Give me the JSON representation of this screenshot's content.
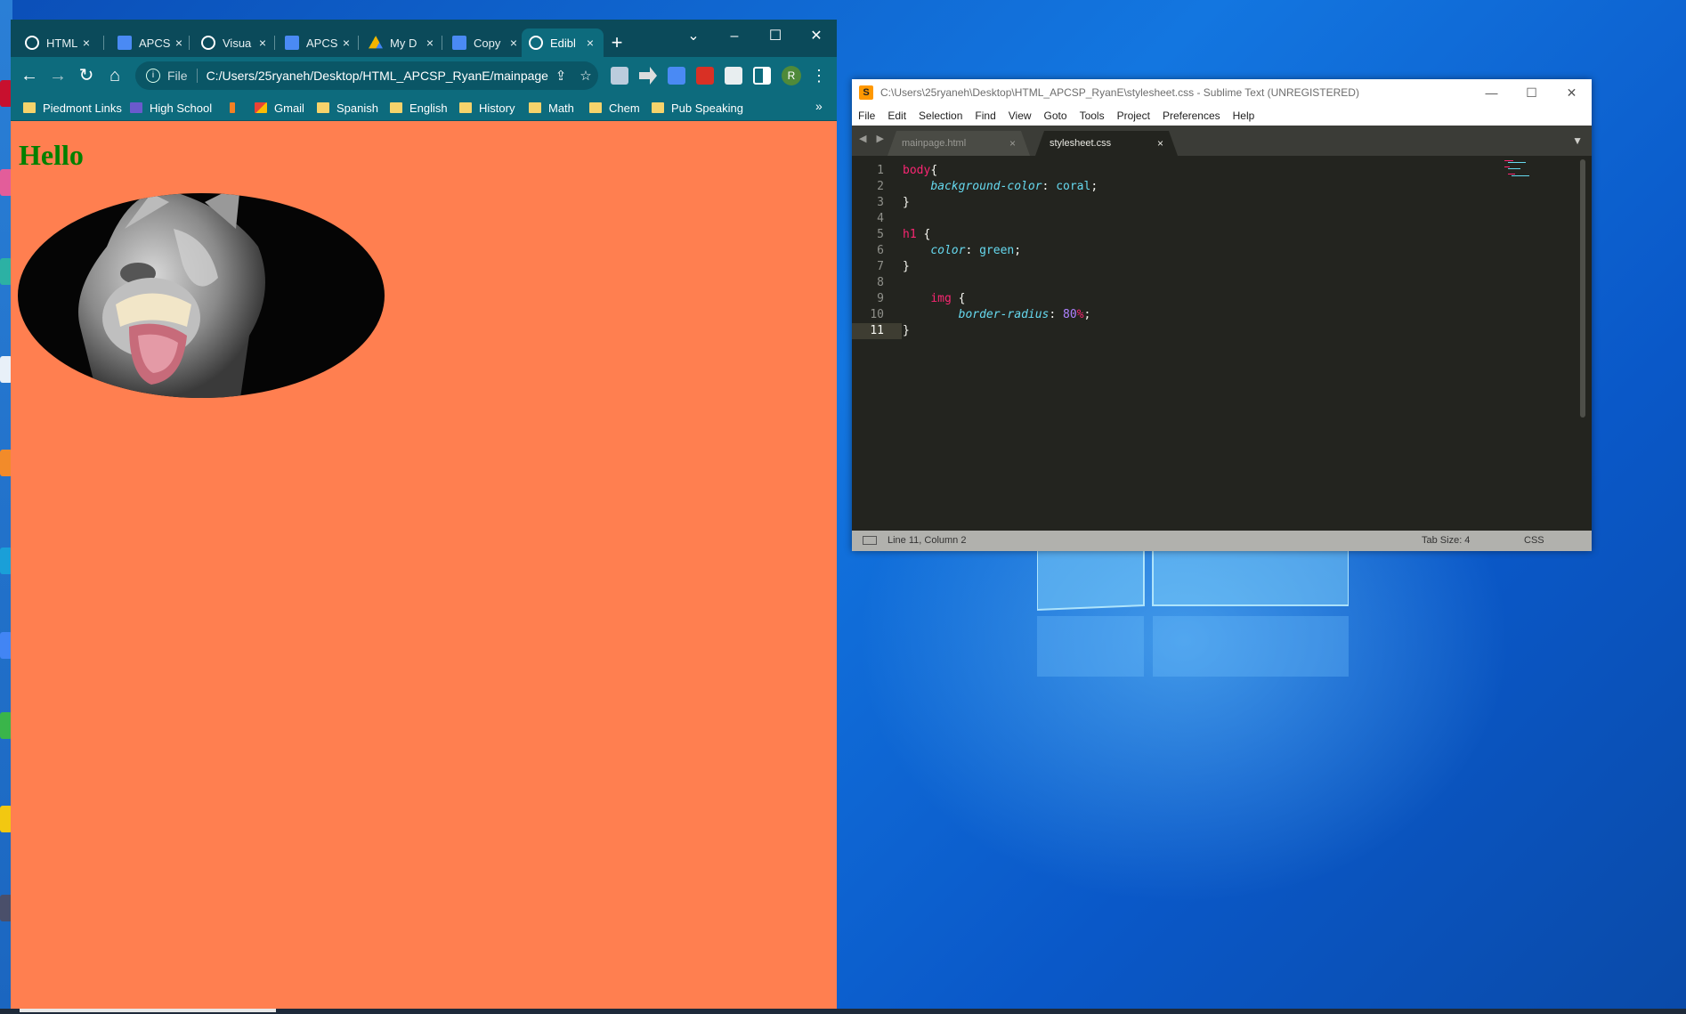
{
  "colors": {
    "chrome_frame": "#0b4a5a",
    "chrome_toolbar": "#0d6b7d",
    "page_background": "coral",
    "heading_color": "green",
    "sublime_bg": "#23241f",
    "desktop_blue": "#1376e0"
  },
  "browser": {
    "tabs": [
      {
        "label": "HTML",
        "icon": "sparknotes-icon",
        "close": "×"
      },
      {
        "label": "APCS",
        "icon": "docs-icon",
        "close": "×"
      },
      {
        "label": "Visua",
        "icon": "sparknotes-icon",
        "close": "×"
      },
      {
        "label": "APCS",
        "icon": "docs-icon",
        "close": "×"
      },
      {
        "label": "My D",
        "icon": "drive-icon",
        "close": "×"
      },
      {
        "label": "Copy",
        "icon": "docs-icon",
        "close": "×"
      },
      {
        "label": "Edibl",
        "icon": "globe-icon",
        "close": "×",
        "active": true
      }
    ],
    "new_tab": "+",
    "tab_search": "⌄",
    "window_controls": {
      "minimize": "–",
      "maximize": "☐",
      "close": "✕"
    },
    "nav": {
      "back": "←",
      "forward": "→",
      "reload": "↻",
      "home": "⌂"
    },
    "address": {
      "info": "i",
      "scheme": "File",
      "url": "C:/Users/25ryaneh/Desktop/HTML_APCSP_RyanE/mainpage...",
      "share": "⇪",
      "star": "☆"
    },
    "profile_initial": "R",
    "menu": "⋮",
    "bookmarks": [
      {
        "label": "Piedmont Links",
        "icon": "folder-icon"
      },
      {
        "label": "High School",
        "icon": "high-school-icon"
      },
      {
        "label": "",
        "icon": "bookmark-icon"
      },
      {
        "label": "Gmail",
        "icon": "gmail-icon"
      },
      {
        "label": "Spanish",
        "icon": "folder-icon"
      },
      {
        "label": "English",
        "icon": "folder-icon"
      },
      {
        "label": "History",
        "icon": "folder-icon"
      },
      {
        "label": "Math",
        "icon": "folder-icon"
      },
      {
        "label": "Chem",
        "icon": "folder-icon"
      },
      {
        "label": "Pub Speaking",
        "icon": "folder-icon"
      }
    ],
    "bookmarks_more": "»",
    "page": {
      "heading": "Hello"
    }
  },
  "sublime": {
    "title": "C:\\Users\\25ryaneh\\Desktop\\HTML_APCSP_RyanE\\stylesheet.css - Sublime Text (UNREGISTERED)",
    "window_controls": {
      "minimize": "—",
      "maximize": "☐",
      "close": "✕"
    },
    "menu": [
      "File",
      "Edit",
      "Selection",
      "Find",
      "View",
      "Goto",
      "Tools",
      "Project",
      "Preferences",
      "Help"
    ],
    "tab_arrows": "◀ ▶",
    "tabs": [
      {
        "label": "mainpage.html",
        "close": "×",
        "active": false
      },
      {
        "label": "stylesheet.css",
        "close": "×",
        "active": true
      }
    ],
    "tab_menu": "▼",
    "line_numbers": [
      "1",
      "2",
      "3",
      "4",
      "5",
      "6",
      "7",
      "8",
      "9",
      "10",
      "11"
    ],
    "code": [
      {
        "selector": "body",
        "open": "{"
      },
      {
        "indent": "    ",
        "property": "background-color",
        "value": "coral"
      },
      {
        "close": "}"
      },
      {},
      {
        "selector": "h1",
        "open": " {"
      },
      {
        "indent": "    ",
        "property": "color",
        "value": "green"
      },
      {
        "close": "}"
      },
      {},
      {
        "indent": "    ",
        "selector": "img",
        "open": " {"
      },
      {
        "indent": "        ",
        "property": "border-radius",
        "number": "80",
        "unit": "%"
      },
      {
        "close": "}"
      }
    ],
    "status": {
      "position": "Line 11, Column 2",
      "tab_size": "Tab Size: 4",
      "syntax": "CSS"
    }
  }
}
